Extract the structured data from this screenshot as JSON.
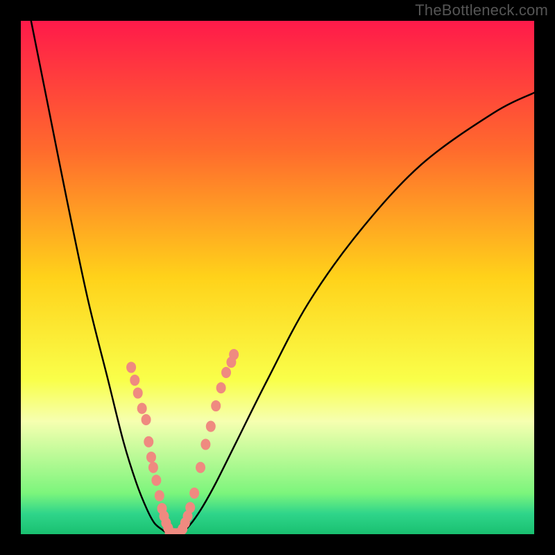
{
  "watermark": "TheBottleneck.com",
  "chart_data": {
    "type": "line",
    "title": "",
    "xlabel": "",
    "ylabel": "",
    "xlim": [
      0,
      100
    ],
    "ylim": [
      0,
      100
    ],
    "grid": false,
    "legend": false,
    "background_gradient_stops": [
      {
        "offset": 0.0,
        "color": "#ff1a4a"
      },
      {
        "offset": 0.25,
        "color": "#ff6a2d"
      },
      {
        "offset": 0.5,
        "color": "#ffd21a"
      },
      {
        "offset": 0.7,
        "color": "#f9ff4a"
      },
      {
        "offset": 0.78,
        "color": "#f6ffb0"
      },
      {
        "offset": 0.92,
        "color": "#7cf57c"
      },
      {
        "offset": 0.96,
        "color": "#2fd58a"
      },
      {
        "offset": 1.0,
        "color": "#19c070"
      }
    ],
    "series": [
      {
        "name": "left_branch",
        "type": "curve",
        "x": [
          2,
          5,
          9,
          13,
          17,
          20,
          22.5,
          24.5,
          26,
          27.5,
          28.2,
          29.0
        ],
        "y": [
          100,
          85,
          65,
          46,
          30,
          18,
          10,
          5,
          2.2,
          0.9,
          0.4,
          0.1
        ]
      },
      {
        "name": "right_branch",
        "type": "curve",
        "x": [
          31.0,
          32.0,
          33.5,
          35.5,
          38,
          42,
          48,
          56,
          66,
          78,
          92,
          100
        ],
        "y": [
          0.1,
          0.8,
          2.5,
          5.5,
          10,
          18,
          30,
          45,
          59,
          72,
          82,
          86
        ]
      },
      {
        "name": "left_highlight_points",
        "type": "scatter",
        "color": "#ef8a80",
        "x": [
          21.5,
          22.2,
          22.8,
          23.6,
          24.4,
          24.9,
          25.4,
          25.8,
          26.4,
          27.0,
          27.5,
          27.9,
          28.3,
          28.7,
          29.0
        ],
        "y": [
          32.5,
          30.0,
          27.5,
          24.5,
          22.3,
          18.0,
          15.0,
          13.0,
          10.5,
          7.5,
          5.0,
          3.5,
          2.2,
          1.2,
          0.5
        ]
      },
      {
        "name": "valley_highlight_points",
        "type": "scatter",
        "color": "#ef8a80",
        "x": [
          29.0,
          29.5,
          30.0,
          30.5,
          31.0
        ],
        "y": [
          0.2,
          0.1,
          0.1,
          0.1,
          0.2
        ]
      },
      {
        "name": "right_highlight_points",
        "type": "scatter",
        "color": "#ef8a80",
        "x": [
          31.5,
          32.0,
          32.5,
          33.0,
          33.8,
          35.0,
          36.0,
          37.0,
          38.0,
          39.0,
          40.0,
          41.0,
          41.5
        ],
        "y": [
          1.0,
          2.2,
          3.5,
          5.2,
          8.0,
          13.0,
          17.5,
          21.0,
          25.0,
          28.5,
          31.5,
          33.5,
          35.0
        ]
      }
    ]
  }
}
